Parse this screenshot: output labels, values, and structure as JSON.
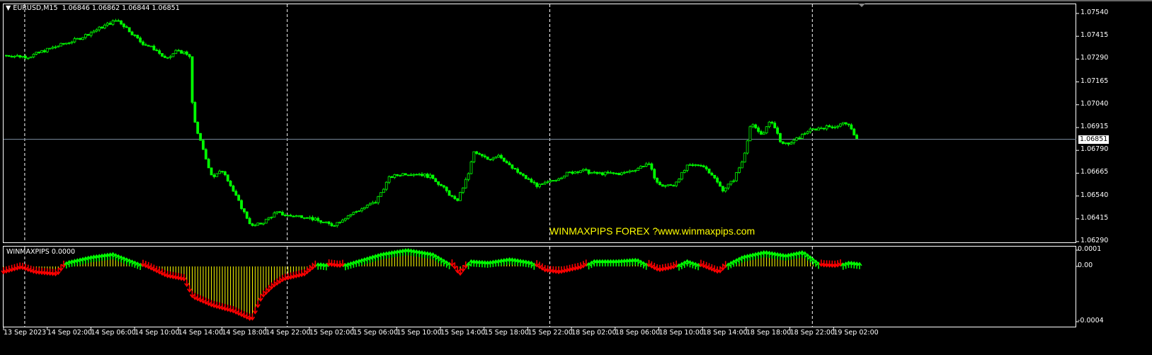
{
  "header": {
    "symbol": "EURUSD,M15",
    "ohlc": "1.06846 1.06862 1.06844 1.06851"
  },
  "indicator": {
    "label": "WINMAXPIPS 0.0000"
  },
  "watermark": "WINMAXPIPS FOREX ?www.winmaxpips.com",
  "colors": {
    "bull": "#00ff00",
    "bear": "#ff0000",
    "hist": "#ffff00",
    "grid": "#ffffff",
    "price_line": "#778899"
  },
  "chart_data": [
    {
      "type": "candlestick",
      "title": "EURUSD,M15",
      "current_price": "1.06851",
      "ylim": [
        1.0629,
        1.0754
      ],
      "yticks": [
        "1.07540",
        "1.07415",
        "1.07290",
        "1.07165",
        "1.07040",
        "1.06915",
        "1.06790",
        "1.06665",
        "1.06540",
        "1.06415",
        "1.06290"
      ],
      "x_unit": "bar_hours",
      "xticks": [
        "13 Sep 2023",
        "14 Sep 02:00",
        "14 Sep 06:00",
        "14 Sep 10:00",
        "14 Sep 14:00",
        "14 Sep 18:00",
        "14 Sep 22:00",
        "15 Sep 02:00",
        "15 Sep 06:00",
        "15 Sep 10:00",
        "15 Sep 14:00",
        "15 Sep 18:00",
        "15 Sep 22:00",
        "18 Sep 02:00",
        "18 Sep 06:00",
        "18 Sep 10:00",
        "18 Sep 14:00",
        "18 Sep 18:00",
        "18 Sep 22:00",
        "19 Sep 02:00"
      ],
      "day_separators_hours": [
        2,
        26,
        50,
        74
      ],
      "close_path": [
        [
          0,
          1.07311
        ],
        [
          2.3,
          1.07303
        ],
        [
          3.6,
          1.07334
        ],
        [
          5.5,
          1.07373
        ],
        [
          6.8,
          1.074
        ],
        [
          8.1,
          1.07439
        ],
        [
          9.4,
          1.07478
        ],
        [
          10.4,
          1.07505
        ],
        [
          11.3,
          1.07458
        ],
        [
          12.6,
          1.07381
        ],
        [
          13.9,
          1.07342
        ],
        [
          14.9,
          1.07284
        ],
        [
          15.9,
          1.07342
        ],
        [
          17.0,
          1.07303
        ],
        [
          17.3,
          1.06993
        ],
        [
          17.8,
          1.06876
        ],
        [
          18.4,
          1.0676
        ],
        [
          19.1,
          1.06643
        ],
        [
          20.1,
          1.06682
        ],
        [
          21.0,
          1.06566
        ],
        [
          22.0,
          1.06449
        ],
        [
          22.7,
          1.06372
        ],
        [
          23.6,
          1.06391
        ],
        [
          24.9,
          1.06449
        ],
        [
          26.2,
          1.0643
        ],
        [
          27.5,
          1.0643
        ],
        [
          28.8,
          1.06403
        ],
        [
          30.1,
          1.06379
        ],
        [
          31.4,
          1.0643
        ],
        [
          32.7,
          1.06469
        ],
        [
          34.0,
          1.06507
        ],
        [
          35.3,
          1.06643
        ],
        [
          36.6,
          1.06663
        ],
        [
          37.9,
          1.06663
        ],
        [
          39.2,
          1.06643
        ],
        [
          40.5,
          1.06566
        ],
        [
          41.4,
          1.06507
        ],
        [
          42.4,
          1.06643
        ],
        [
          43.0,
          1.06779
        ],
        [
          44.3,
          1.0674
        ],
        [
          45.3,
          1.06767
        ],
        [
          46.3,
          1.06701
        ],
        [
          47.6,
          1.06643
        ],
        [
          48.9,
          1.06593
        ],
        [
          50.2,
          1.06624
        ],
        [
          51.5,
          1.06663
        ],
        [
          52.8,
          1.06682
        ],
        [
          54.0,
          1.06663
        ],
        [
          55.3,
          1.06663
        ],
        [
          56.6,
          1.06663
        ],
        [
          57.9,
          1.0669
        ],
        [
          58.9,
          1.06721
        ],
        [
          59.9,
          1.06597
        ],
        [
          61.2,
          1.06597
        ],
        [
          62.5,
          1.06701
        ],
        [
          63.8,
          1.06713
        ],
        [
          64.7,
          1.06663
        ],
        [
          65.7,
          1.06573
        ],
        [
          66.7,
          1.06624
        ],
        [
          67.6,
          1.0674
        ],
        [
          68.3,
          1.06934
        ],
        [
          69.3,
          1.06876
        ],
        [
          70.2,
          1.06954
        ],
        [
          71.2,
          1.06818
        ],
        [
          72.2,
          1.06837
        ],
        [
          73.5,
          1.06896
        ],
        [
          74.8,
          1.06915
        ],
        [
          76.1,
          1.06923
        ],
        [
          77.0,
          1.06942
        ],
        [
          78.1,
          1.06851
        ]
      ]
    },
    {
      "type": "histogram",
      "title": "WINMAXPIPS",
      "ylim": [
        -0.00043,
        0.00012
      ],
      "yticks": [
        "0.0001",
        "0.00",
        "-0.0004"
      ],
      "value_scale": 0.0001,
      "values": [
        [
          0,
          -0.43
        ],
        [
          1.6,
          -0.1
        ],
        [
          2.9,
          -0.43
        ],
        [
          4.9,
          -0.57
        ],
        [
          5.8,
          0.29
        ],
        [
          8.1,
          0.67
        ],
        [
          10.0,
          0.86
        ],
        [
          12.0,
          0.29
        ],
        [
          13.3,
          -0.1
        ],
        [
          14.9,
          -0.67
        ],
        [
          16.5,
          -0.9
        ],
        [
          17.3,
          -2.1
        ],
        [
          19.1,
          -2.67
        ],
        [
          21.0,
          -3.05
        ],
        [
          22.7,
          -3.62
        ],
        [
          23.6,
          -2.1
        ],
        [
          24.6,
          -1.38
        ],
        [
          25.6,
          -0.9
        ],
        [
          27.5,
          -0.57
        ],
        [
          28.8,
          0.19
        ],
        [
          30.7,
          0.0
        ],
        [
          32.0,
          0.29
        ],
        [
          34.6,
          0.86
        ],
        [
          36.9,
          1.14
        ],
        [
          39.2,
          0.86
        ],
        [
          41.1,
          0.05
        ],
        [
          41.7,
          -0.57
        ],
        [
          42.7,
          0.38
        ],
        [
          44.3,
          0.29
        ],
        [
          46.3,
          0.52
        ],
        [
          48.2,
          0.29
        ],
        [
          49.5,
          -0.29
        ],
        [
          50.8,
          -0.43
        ],
        [
          52.8,
          -0.1
        ],
        [
          54.0,
          0.38
        ],
        [
          56.0,
          0.38
        ],
        [
          57.9,
          0.48
        ],
        [
          59.9,
          -0.29
        ],
        [
          61.2,
          -0.1
        ],
        [
          62.5,
          0.38
        ],
        [
          63.8,
          0.05
        ],
        [
          65.4,
          -0.43
        ],
        [
          66.3,
          0.19
        ],
        [
          67.6,
          0.67
        ],
        [
          69.6,
          1.0
        ],
        [
          71.5,
          0.76
        ],
        [
          73.1,
          1.0
        ],
        [
          74.8,
          0.05
        ],
        [
          76.1,
          0.0
        ],
        [
          77.3,
          0.29
        ],
        [
          78.3,
          0.19
        ]
      ]
    }
  ]
}
